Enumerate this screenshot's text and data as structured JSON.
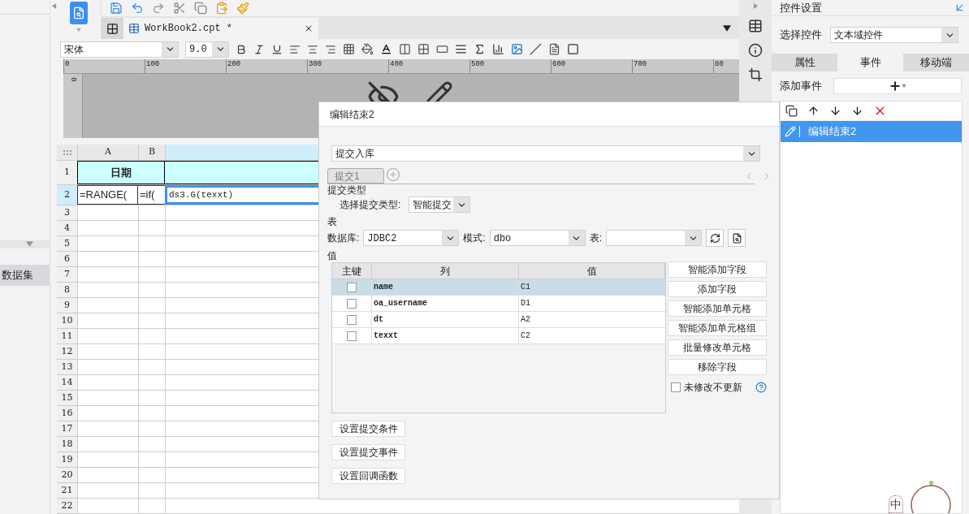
{
  "left_panel": {
    "items": [
      {
        "label": "数据集",
        "selected": true
      }
    ]
  },
  "document_tabs": [
    {
      "label": "WorkBook2.cpt *",
      "selected": true
    }
  ],
  "format_toolbar": {
    "font": "宋体",
    "size": "9.0"
  },
  "ruler": {
    "ticks": [
      "0",
      "100",
      "200",
      "300",
      "400",
      "500",
      "600",
      "700",
      "80"
    ],
    "vertical_tick": "0"
  },
  "sheet": {
    "columns": [
      {
        "label": "A",
        "selected": false
      },
      {
        "label": "B",
        "selected": false
      },
      {
        "selected": true
      }
    ],
    "row_numbers": [
      {
        "label": "1",
        "selected": false
      },
      {
        "label": "2",
        "selected": true
      },
      {
        "label": "3",
        "selected": false
      },
      {
        "label": "4",
        "selected": false
      },
      {
        "label": "5",
        "selected": false
      },
      {
        "label": "6",
        "selected": false
      },
      {
        "label": "7",
        "selected": false
      },
      {
        "label": "8",
        "selected": false
      },
      {
        "label": "9",
        "selected": false
      },
      {
        "label": "10",
        "selected": false
      },
      {
        "label": "11",
        "selected": false
      },
      {
        "label": "12",
        "selected": false
      },
      {
        "label": "13",
        "selected": false
      },
      {
        "label": "14",
        "selected": false
      },
      {
        "label": "15",
        "selected": false
      },
      {
        "label": "16",
        "selected": false
      },
      {
        "label": "17",
        "selected": false
      },
      {
        "label": "18",
        "selected": false
      },
      {
        "label": "19",
        "selected": false
      },
      {
        "label": "20",
        "selected": false
      },
      {
        "label": "21",
        "selected": false
      },
      {
        "label": "22",
        "selected": false
      }
    ],
    "header_cell": "日期",
    "row2": [
      {
        "text": "=RANGE(",
        "selected": false
      },
      {
        "text": "=if(",
        "selected": false
      },
      {
        "text": "ds3.G(texxt)",
        "selected": true
      }
    ]
  },
  "dialog": {
    "title": "编辑结束2",
    "action": "提交入库",
    "tabs": [
      {
        "label": "提交1",
        "selected": true
      }
    ],
    "submit_section": "提交类型",
    "submit_type_label": "选择提交类型:",
    "submit_type": "智能提交",
    "table_section": "表",
    "database_label": "数据库:",
    "database": "JDBC2",
    "schema_label": "模式:",
    "schema": "dbo",
    "table_label": "表:",
    "value_section": "值",
    "columns": [
      "主键",
      "列",
      "值"
    ],
    "rows": [
      {
        "key": false,
        "column": "name",
        "value": "C1",
        "selected": true
      },
      {
        "key": false,
        "column": "oa_username",
        "value": "D1",
        "selected": false
      },
      {
        "key": false,
        "column": "dt",
        "value": "A2",
        "selected": false
      },
      {
        "key": false,
        "column": "texxt",
        "value": "C2",
        "selected": false
      }
    ],
    "side_buttons": [
      "智能添加字段",
      "添加字段",
      "智能添加单元格",
      "智能添加单元格组",
      "批量修改单元格",
      "移除字段"
    ],
    "no_update_unchanged": {
      "label": "未修改不更新",
      "checked": false
    },
    "bottom_buttons": [
      "设置提交条件",
      "设置提交事件",
      "设置回调函数"
    ]
  },
  "right_panel": {
    "title": "控件设置",
    "select_label": "选择控件",
    "select_value": "文本域控件",
    "tabs": [
      {
        "label": "属性",
        "selected": false
      },
      {
        "label": "事件",
        "selected": true
      },
      {
        "label": "移动端",
        "selected": false
      }
    ],
    "add_event_label": "添加事件",
    "events": [
      {
        "label": "编辑结束2",
        "selected": true
      }
    ]
  },
  "ime": {
    "label": "中"
  }
}
